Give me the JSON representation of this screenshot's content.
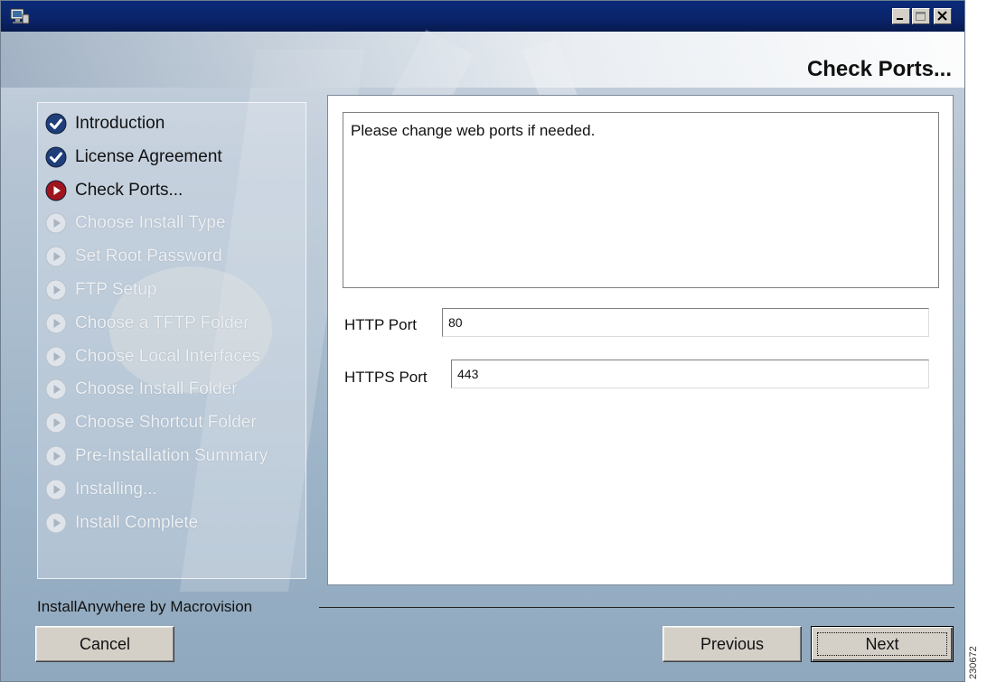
{
  "window": {
    "page_title": "Check Ports..."
  },
  "steps": [
    {
      "label": "Introduction",
      "state": "done"
    },
    {
      "label": "License Agreement",
      "state": "done"
    },
    {
      "label": "Check Ports...",
      "state": "current"
    },
    {
      "label": "Choose Install Type",
      "state": "future"
    },
    {
      "label": "Set Root Password",
      "state": "future"
    },
    {
      "label": "FTP Setup",
      "state": "future"
    },
    {
      "label": "Choose a TFTP Folder",
      "state": "future"
    },
    {
      "label": "Choose Local Interfaces",
      "state": "future"
    },
    {
      "label": "Choose Install Folder",
      "state": "future"
    },
    {
      "label": "Choose Shortcut Folder",
      "state": "future"
    },
    {
      "label": "Pre-Installation Summary",
      "state": "future"
    },
    {
      "label": "Installing...",
      "state": "future"
    },
    {
      "label": "Install Complete",
      "state": "future"
    }
  ],
  "content": {
    "message": "Please change web ports if needed.",
    "http_label": "HTTP Port",
    "http_value": "80",
    "https_label": "HTTPS Port",
    "https_value": "443"
  },
  "footer": {
    "vendor": "InstallAnywhere by Macrovision",
    "cancel_label": "Cancel",
    "previous_label": "Previous",
    "next_label": "Next"
  },
  "side_stamp": "230672",
  "colors": {
    "titlebar": "#0a246a",
    "done_icon": "#1f3f7a",
    "current_icon": "#a0141e",
    "future_icon": "#dfe4ea",
    "button_face": "#d4d0c8"
  },
  "icons": {
    "done": "checkmark-circle-icon",
    "current": "play-circle-icon",
    "future": "play-circle-icon"
  }
}
